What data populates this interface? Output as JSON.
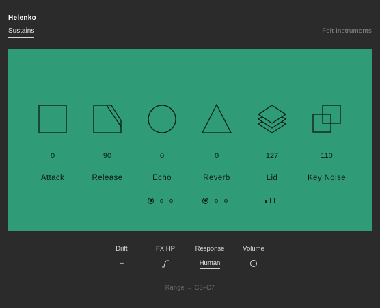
{
  "header": {
    "title": "Helenko",
    "preset": "Sustains",
    "brand": "Felt Instruments"
  },
  "controls": [
    {
      "name": "Attack",
      "value": "0",
      "icon": "square-icon"
    },
    {
      "name": "Release",
      "value": "90",
      "icon": "sheared-square-icon"
    },
    {
      "name": "Echo",
      "value": "0",
      "icon": "circle-icon"
    },
    {
      "name": "Reverb",
      "value": "0",
      "icon": "triangle-icon"
    },
    {
      "name": "Lid",
      "value": "127",
      "icon": "stacked-diamonds-icon"
    },
    {
      "name": "Key Noise",
      "value": "110",
      "icon": "overlapping-squares-icon"
    }
  ],
  "echo_modes": {
    "selected": 0,
    "count": 3
  },
  "reverb_modes": {
    "selected": 0,
    "count": 3
  },
  "bottom": {
    "drift": {
      "label": "Drift",
      "value": "–"
    },
    "fx_hp": {
      "label": "FX HP",
      "icon": "highpass-filter-icon"
    },
    "response": {
      "label": "Response",
      "value": "Human"
    },
    "volume": {
      "label": "Volume",
      "icon": "knob-circle-icon"
    }
  },
  "range": "Range → C3–C7",
  "colors": {
    "background": "#2b2b2b",
    "panel": "#2f9b77",
    "ink": "#101a15"
  }
}
